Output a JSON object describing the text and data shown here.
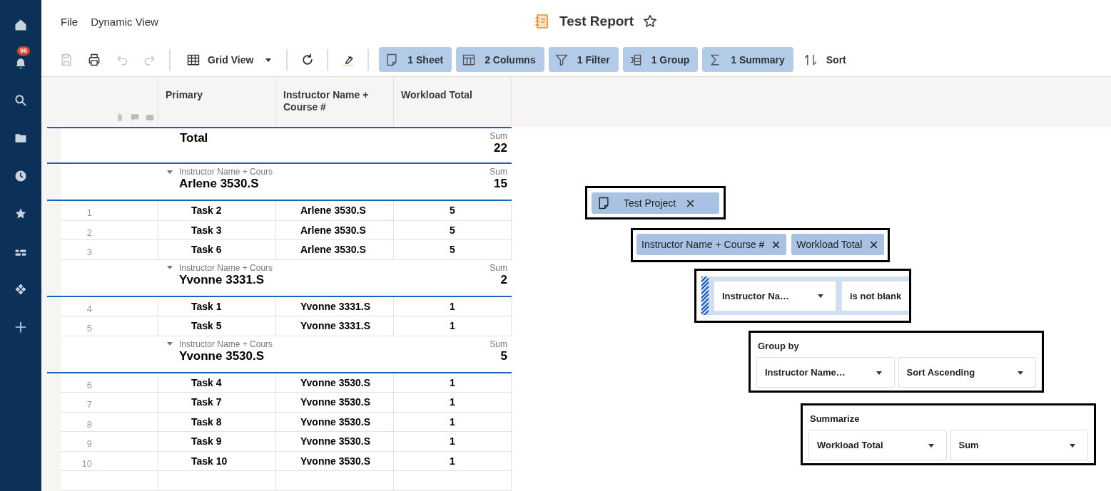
{
  "sidebar": {
    "items": [
      {
        "kind": "home"
      },
      {
        "kind": "notifications",
        "badge": "96"
      },
      {
        "kind": "search"
      },
      {
        "kind": "folder"
      },
      {
        "kind": "recent"
      },
      {
        "kind": "favorites"
      },
      {
        "kind": "people"
      },
      {
        "kind": "apps"
      },
      {
        "kind": "add"
      }
    ]
  },
  "menu": [
    "File",
    "Dynamic View"
  ],
  "title": "Test Report",
  "toolbar": {
    "items": [
      {
        "kind": "save",
        "disabled": true
      },
      {
        "kind": "print",
        "disabled": false
      },
      {
        "kind": "undo",
        "disabled": true
      },
      {
        "kind": "redo",
        "disabled": true
      },
      {
        "kind": "separator"
      },
      {
        "kind": "view",
        "label": "Grid View"
      },
      {
        "kind": "separator"
      },
      {
        "kind": "refresh",
        "disabled": false
      },
      {
        "kind": "separator"
      },
      {
        "kind": "highlight",
        "disabled": false
      },
      {
        "kind": "separator"
      },
      {
        "kind": "sheets",
        "label": "1 Sheet",
        "active": true
      },
      {
        "kind": "columns",
        "label": "2 Columns",
        "active": true
      },
      {
        "kind": "filter",
        "label": "1 Filter",
        "active": true
      },
      {
        "kind": "group",
        "label": "1 Group",
        "active": true
      },
      {
        "kind": "summary",
        "label": "1 Summary",
        "active": true
      },
      {
        "kind": "sort",
        "label": "Sort",
        "active": false
      }
    ]
  },
  "grid": {
    "columns": [
      "Primary",
      "Instructor Name + Course #",
      "Workload Total"
    ],
    "total": {
      "label": "Total",
      "summary_label": "Sum",
      "value": "22"
    },
    "groups": [
      {
        "caption": "Instructor Name + Cours",
        "name": "Arlene 3530.S",
        "expanded": true,
        "summary_label": "Sum",
        "value": "15",
        "rows": [
          {
            "number": "1",
            "primary": "Task 2",
            "instructor": "Arlene 3530.S",
            "workload": "5"
          },
          {
            "number": "2",
            "primary": "Task 3",
            "instructor": "Arlene 3530.S",
            "workload": "5"
          },
          {
            "number": "3",
            "primary": "Task 6",
            "instructor": "Arlene 3530.S",
            "workload": "5"
          }
        ]
      },
      {
        "caption": "Instructor Name + Cours",
        "name": "Yvonne 3331.S",
        "expanded": true,
        "summary_label": "Sum",
        "value": "2",
        "rows": [
          {
            "number": "4",
            "primary": "Task 1",
            "instructor": "Yvonne 3331.S",
            "workload": "1"
          },
          {
            "number": "5",
            "primary": "Task 5",
            "instructor": "Yvonne 3331.S",
            "workload": "1"
          }
        ]
      },
      {
        "caption": "Instructor Name + Cours",
        "name": "Yvonne 3530.S",
        "expanded": true,
        "summary_label": "Sum",
        "value": "5",
        "rows": [
          {
            "number": "6",
            "primary": "Task 4",
            "instructor": "Yvonne 3530.S",
            "workload": "1"
          },
          {
            "number": "7",
            "primary": "Task 7",
            "instructor": "Yvonne 3530.S",
            "workload": "1"
          },
          {
            "number": "8",
            "primary": "Task 8",
            "instructor": "Yvonne 3530.S",
            "workload": "1"
          },
          {
            "number": "9",
            "primary": "Task 9",
            "instructor": "Yvonne 3530.S",
            "workload": "1"
          },
          {
            "number": "10",
            "primary": "Task 10",
            "instructor": "Yvonne 3530.S",
            "workload": "1"
          }
        ]
      }
    ]
  },
  "callouts": {
    "sheets": [
      "Test Project"
    ],
    "columns": [
      "Instructor Name + Course #",
      "Workload Total"
    ],
    "filter": {
      "field": "Instructor Na…",
      "condition": "is not blank"
    },
    "group_by": {
      "title": "Group by",
      "field": "Instructor Name…",
      "order": "Sort Ascending"
    },
    "summarize": {
      "title": "Summarize",
      "field": "Workload Total",
      "function": "Sum"
    }
  }
}
